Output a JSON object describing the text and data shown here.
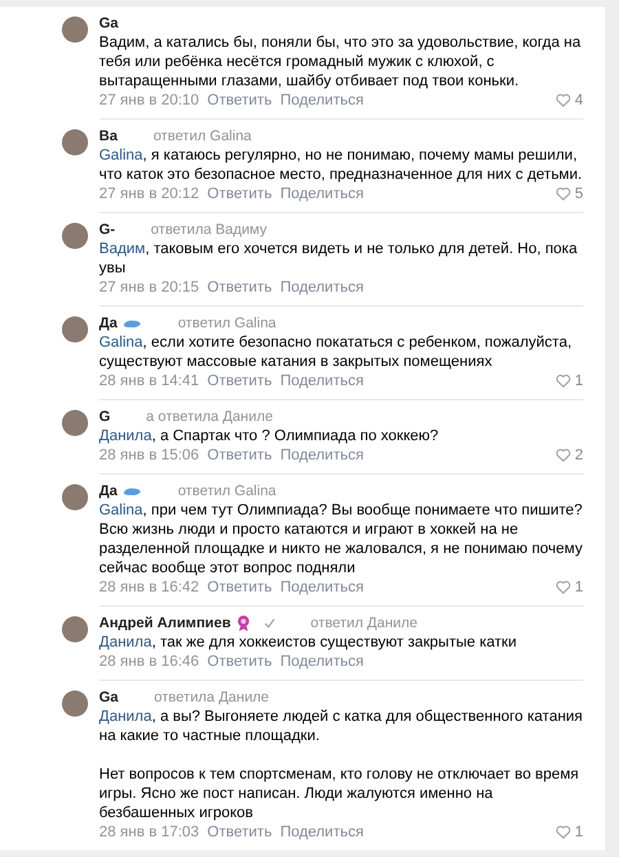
{
  "comments": [
    {
      "author": "Ga",
      "paragraphs": [
        "Вадим, а катались бы, поняли бы, что это за удовольствие, когда на тебя или ребёнка несётся громадный мужик с клюхой, с вытаращенными глазами, шайбу отбивает под твои коньки."
      ],
      "date": "27 янв в 20:10",
      "reply": "Ответить",
      "share": "Поделиться",
      "likes": "4"
    },
    {
      "author": "Ва",
      "reply_to": "ответил Galina",
      "mention": "Galina",
      "paragraphs": [
        ", я катаюсь регулярно, но не понимаю, почему мамы решили, что каток это безопасное место, предназначенное для них с детьми."
      ],
      "date": "27 янв в 20:12",
      "reply": "Ответить",
      "share": "Поделиться",
      "likes": "5"
    },
    {
      "author": "G-",
      "reply_to": "ответила Вадиму",
      "mention": "Вадим",
      "paragraphs": [
        ", таковым его хочется видеть и не только для детей. Но, пока увы"
      ],
      "date": "27 янв в 20:15",
      "reply": "Ответить",
      "share": "Поделиться"
    },
    {
      "author": "Да",
      "badges": [
        {
          "kind": "sticker"
        }
      ],
      "reply_to": "ответил Galina",
      "mention": "Galina",
      "paragraphs": [
        ", если хотите безопасно покататься с ребенком, пожалуйста, существуют массовые катания в закрытых помещениях"
      ],
      "date": "28 янв в 14:41",
      "reply": "Ответить",
      "share": "Поделиться",
      "likes": "1"
    },
    {
      "author": "G",
      "reply_to": "а ответила Даниле",
      "mention": "Данила",
      "paragraphs": [
        ", а Спартак что ? Олимпиада по хоккею?"
      ],
      "date": "28 янв в 15:06",
      "reply": "Ответить",
      "share": "Поделиться",
      "likes": "2"
    },
    {
      "author": "Да",
      "badges": [
        {
          "kind": "sticker"
        }
      ],
      "reply_to": "ответил Galina",
      "mention": "Galina",
      "paragraphs": [
        ", при чем тут Олимпиада? Вы вообще понимаете что пишите? Всю жизнь люди и просто катаются и играют в хоккей на не разделенной площадке и никто не жаловался, я не понимаю почему сейчас вообще этот вопрос подняли"
      ],
      "date": "28 янв в 16:42",
      "reply": "Ответить",
      "share": "Поделиться",
      "likes": "1"
    },
    {
      "author": "Андрей Алимпиев",
      "badges": [
        {
          "kind": "award"
        },
        {
          "kind": "check"
        }
      ],
      "reply_to": "ответил Даниле",
      "mention": "Данила",
      "paragraphs": [
        ", так же для хоккеистов существуют закрытые катки"
      ],
      "date": "28 янв в 16:46",
      "reply": "Ответить",
      "share": "Поделиться"
    },
    {
      "author": "Ga",
      "reply_to": "ответила Даниле",
      "mention": "Данила",
      "paragraphs": [
        ", а вы? Выгоняете людей с катка для общественного катания на какие то частные площадки.",
        "Нет вопросов к тем спортсменам, кто голову не отключает во время игры. Ясно же пост написан. Люди жалуются именно на безбашенных игроков"
      ],
      "date": "28 янв в 17:03",
      "reply": "Ответить",
      "share": "Поделиться",
      "likes": "1"
    }
  ]
}
